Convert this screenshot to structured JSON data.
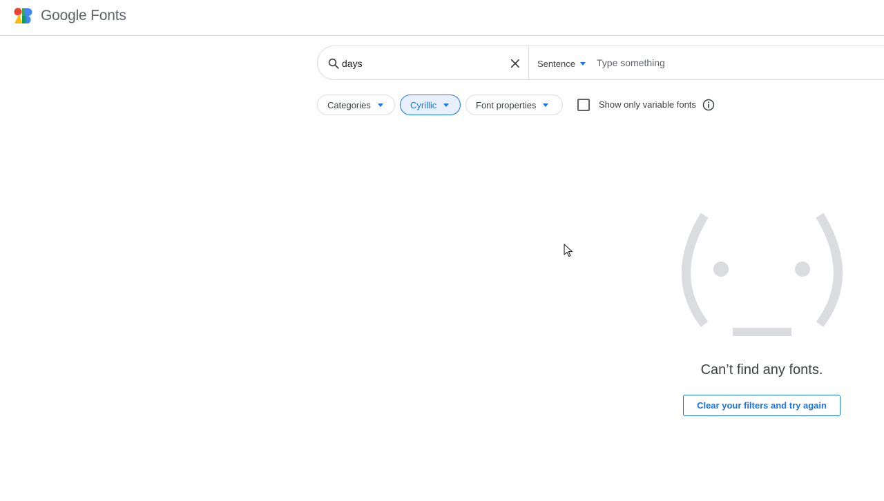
{
  "header": {
    "brand": "Google Fonts",
    "logo_icon": "google-fonts-logo"
  },
  "search": {
    "value": "days",
    "icon": "search-icon",
    "clear_icon": "close-icon",
    "preview_mode": "Sentence",
    "preview_placeholder": "Type something"
  },
  "filters": {
    "chips": [
      {
        "label": "Categories",
        "active": false
      },
      {
        "label": "Cyrillic",
        "active": true
      },
      {
        "label": "Font properties",
        "active": false
      }
    ],
    "variable_checkbox": {
      "label": "Show only variable fonts",
      "checked": false
    },
    "info_icon": "info-icon"
  },
  "empty_state": {
    "message": "Can’t find any fonts.",
    "button_label": "Clear your filters and try again",
    "icon": "sad-face-emoticon"
  },
  "colors": {
    "accent": "#1a73e8",
    "chip_active_bg": "#e8f0fe",
    "border": "#dadce0",
    "text": "#3c4043",
    "empty_face": "#dadce0"
  }
}
